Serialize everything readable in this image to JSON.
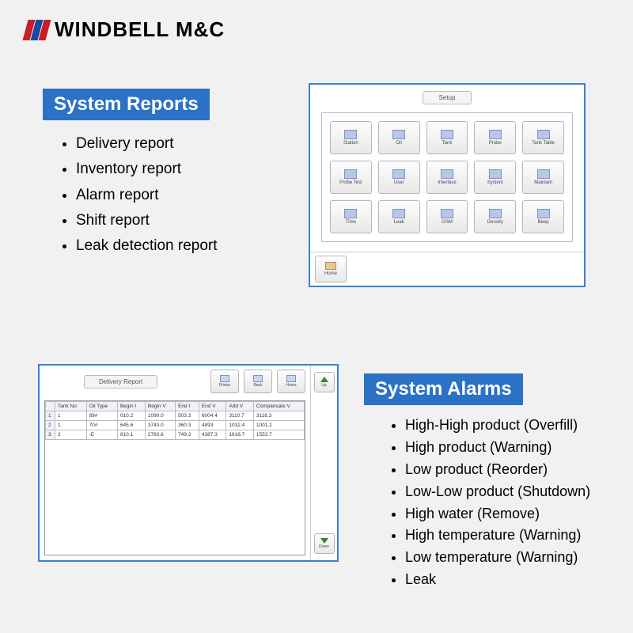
{
  "brand": {
    "name": "WINDBELL M&C"
  },
  "sections": {
    "reports": {
      "heading": "System Reports",
      "items": [
        "Delivery report",
        "Inventory report",
        "Alarm report",
        "Shift report",
        "Leak detection report"
      ]
    },
    "alarms": {
      "heading": "System Alarms",
      "items": [
        "High-High product (Overfill)",
        "High product (Warning)",
        "Low product (Reorder)",
        "Low-Low product (Shutdown)",
        "High water (Remove)",
        "High temperature (Warning)",
        "Low temperature (Warning)",
        "Leak"
      ]
    }
  },
  "setup_panel": {
    "title": "Setup",
    "tiles": [
      "Station",
      "Oil",
      "Tank",
      "Probe",
      "Tank Table",
      "Probe Test",
      "User",
      "Interface",
      "System",
      "Maintain",
      "Time",
      "Leak",
      "GSM",
      "Density",
      "Beep"
    ],
    "home_label": "Home"
  },
  "report_panel": {
    "title": "Delivery Report",
    "toolbar": {
      "printer": "Printer",
      "back": "Back",
      "home": "Home",
      "up": "Up",
      "down": "Down"
    },
    "columns": [
      "Tank No",
      "Oil Type",
      "Begin I",
      "Begin V",
      "End I",
      "End V",
      "Add V",
      "Compansate V"
    ],
    "rows": [
      [
        "1",
        "89#",
        "010.2",
        "1090.0",
        "503.3",
        "6004.4",
        "3110.7",
        "3118.3"
      ],
      [
        "1",
        "70#",
        "645.6",
        "3743.0",
        "360.3",
        "4893",
        "1032.4",
        "1001.2"
      ],
      [
        "2",
        "-E",
        "810.1",
        "2783.6",
        "749.3",
        "4387.3",
        "1618.7",
        "1552.7"
      ]
    ]
  }
}
